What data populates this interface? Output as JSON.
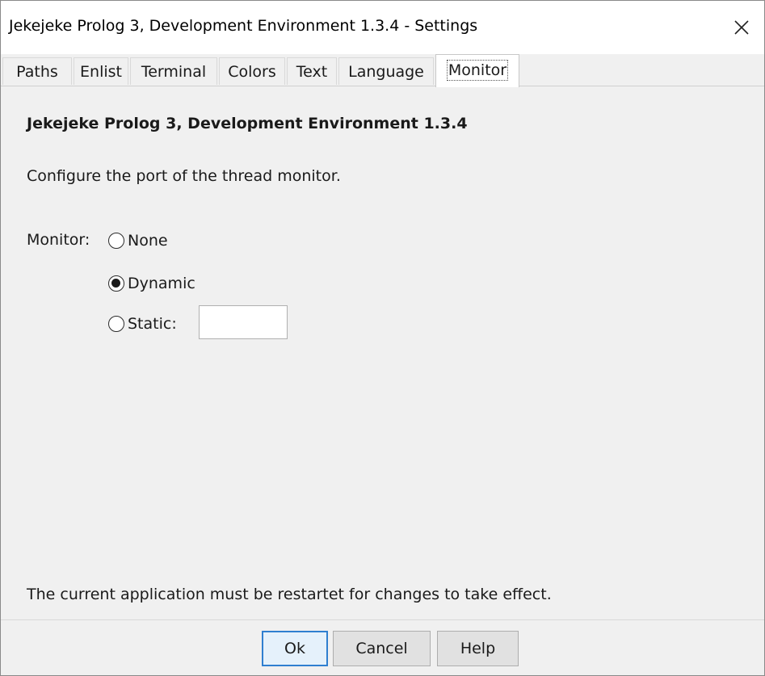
{
  "window": {
    "title": "Jekejeke Prolog 3, Development Environment 1.3.4 - Settings",
    "close_icon": "close-icon"
  },
  "tabs": [
    {
      "label": "Paths",
      "selected": false
    },
    {
      "label": "Enlist",
      "selected": false
    },
    {
      "label": "Terminal",
      "selected": false
    },
    {
      "label": "Colors",
      "selected": false
    },
    {
      "label": "Text",
      "selected": false
    },
    {
      "label": "Language",
      "selected": false
    },
    {
      "label": "Monitor",
      "selected": true
    }
  ],
  "panel": {
    "heading": "Jekejeke Prolog 3, Development Environment 1.3.4",
    "description": "Configure the port of the thread monitor.",
    "monitor_label": "Monitor:",
    "options": {
      "none": {
        "label": "None",
        "checked": false
      },
      "dynamic": {
        "label": "Dynamic",
        "checked": true
      },
      "static": {
        "label": "Static:",
        "checked": false
      }
    },
    "static_port_value": "",
    "note": "The current application must be restartet for changes to take effect."
  },
  "buttons": {
    "ok": "Ok",
    "cancel": "Cancel",
    "help": "Help"
  },
  "colors": {
    "dialog_background": "#f0f0f0",
    "default_button_border": "#2f7fd0"
  }
}
